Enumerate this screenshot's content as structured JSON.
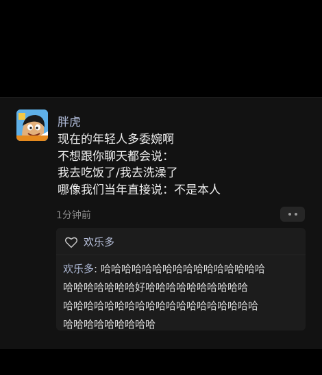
{
  "post": {
    "username": "胖虎",
    "lines": [
      "现在的年轻人多委婉啊",
      "不想跟你聊天都会说：",
      "我去吃饭了/我去洗澡了",
      "哪像我们当年直接说：不是本人"
    ],
    "time": "1分钟前"
  },
  "likes": {
    "names": "欢乐多"
  },
  "comment": {
    "author": "欢乐多",
    "separator": ": ",
    "line1_text": "哈哈哈哈哈哈哈哈哈哈哈哈哈哈哈哈",
    "line2": "哈哈哈哈哈哈哈好哈哈哈哈哈哈哈哈哈哈",
    "line3": "哈哈哈哈哈哈哈哈哈哈哈哈哈哈哈哈哈哈哈",
    "line4": "哈哈哈哈哈哈哈哈哈"
  },
  "colors": {
    "background": "#000000",
    "card": "#121212",
    "name_link": "#aeb9d6",
    "text": "#eeeeee"
  }
}
